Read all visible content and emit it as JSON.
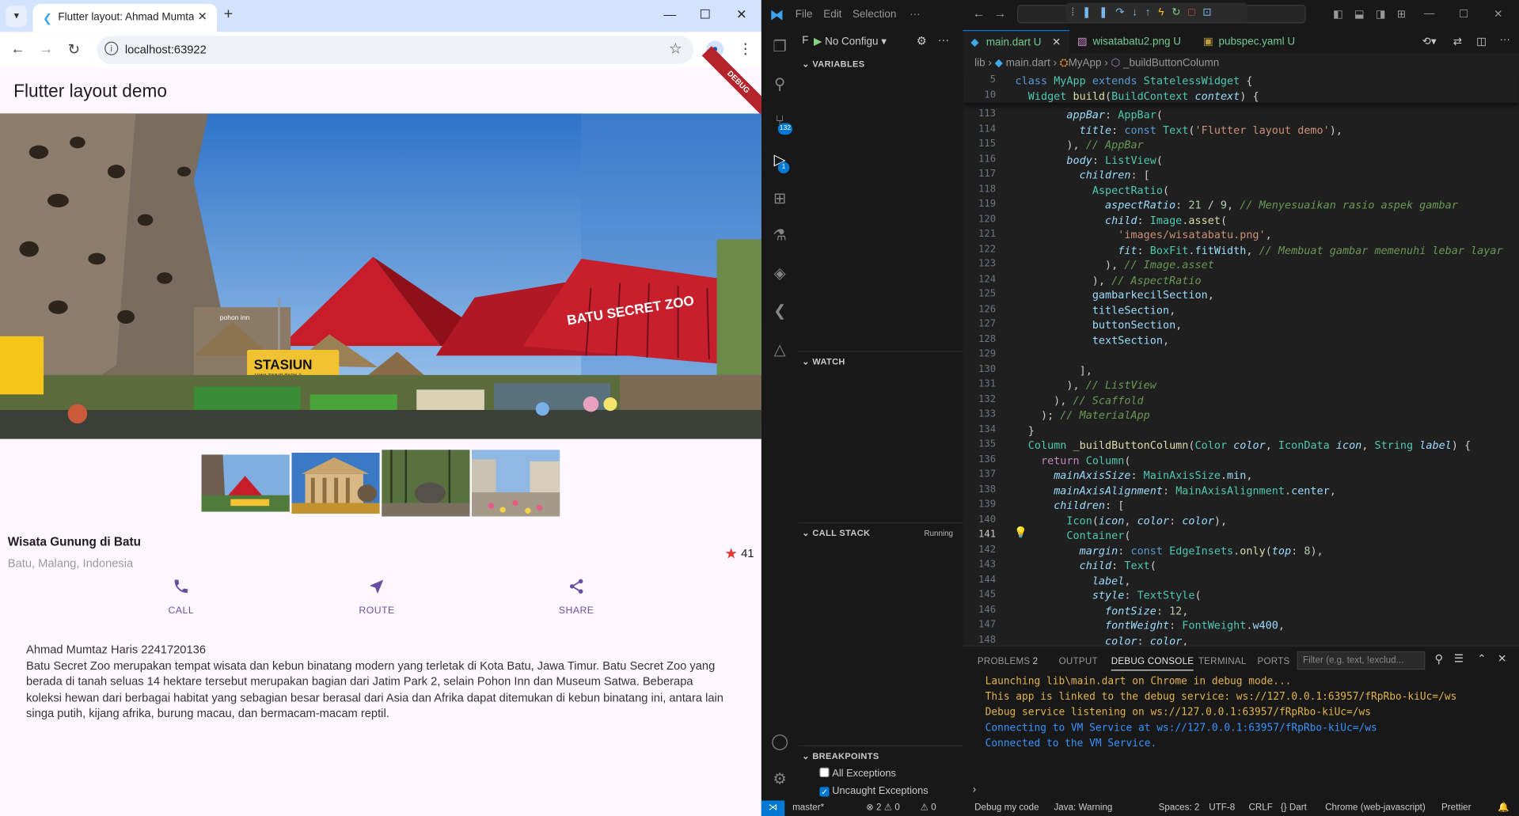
{
  "browser": {
    "tab_title": "Flutter layout: Ahmad Mumtaz",
    "url": "localhost:63922"
  },
  "app": {
    "title": "Flutter layout demo",
    "debug_banner": "DEBUG",
    "place_name": "Wisata Gunung di Batu",
    "location": "Batu, Malang, Indonesia",
    "rating_count": "41",
    "buttons": [
      {
        "label": "CALL"
      },
      {
        "label": "ROUTE"
      },
      {
        "label": "SHARE"
      }
    ],
    "author": "Ahmad Mumtaz Haris 2241720136",
    "description": "Batu Secret Zoo merupakan tempat wisata dan kebun binatang modern yang terletak di Kota Batu, Jawa Timur. Batu Secret Zoo yang berada di tanah seluas 14 hektare tersebut merupakan bagian dari Jatim Park 2, selain Pohon Inn dan Museum Satwa. Beberapa koleksi hewan dari berbagai habitat yang sebagian besar berasal dari Asia dan Afrika dapat ditemukan di kebun binatang ini, antara lain singa putih, kijang afrika, burung macau, dan bermacam-macam reptil.",
    "hero_signs": {
      "zoo": "BATU SECRET ZOO",
      "station": "STASIUN",
      "station_sub": "JAWA TIMUR PARK 2",
      "hotel": "pohon inn"
    }
  },
  "vscode": {
    "menu": [
      "File",
      "Edit",
      "Selection",
      "···"
    ],
    "run_config": "No Configu",
    "sections": {
      "variables": "VARIABLES",
      "watch": "WATCH",
      "call_stack": "CALL STACK",
      "call_stack_status": "Running",
      "breakpoints": "BREAKPOINTS"
    },
    "breakpoints": [
      {
        "label": "All Exceptions",
        "checked": false
      },
      {
        "label": "Uncaught Exceptions",
        "checked": true
      }
    ],
    "badges": {
      "source_control": "132",
      "debug": "1"
    },
    "tabs": [
      {
        "label": "main.dart",
        "suffix": "U"
      },
      {
        "label": "wisatabatu2.png",
        "suffix": "U"
      },
      {
        "label": "pubspec.yaml",
        "suffix": "U"
      }
    ],
    "breadcrumb": [
      "lib",
      "main.dart",
      "MyApp",
      "_buildButtonColumn"
    ],
    "panel_tabs": [
      "PROBLEMS",
      "2",
      "OUTPUT",
      "DEBUG CONSOLE",
      "TERMINAL",
      "PORTS"
    ],
    "filter_placeholder": "Filter (e.g. text, !exclud...",
    "console": [
      "Launching lib\\main.dart on Chrome in debug mode...",
      "This app is linked to the debug service: ws://127.0.0.1:63957/fRpRbo-kiUc=/ws",
      "Debug service listening on ws://127.0.0.1:63957/fRpRbo-kiUc=/ws",
      "Connecting to VM Service at ws://127.0.0.1:63957/fRpRbo-kiUc=/ws",
      "Connected to the VM Service."
    ],
    "status": [
      "master*",
      "⊗ 2 ⚠ 0",
      "⚠ 0",
      "Debug my code",
      "Java: Warning",
      "Spaces: 2",
      "UTF-8",
      "CRLF",
      "{} Dart",
      "Chrome (web-javascript)",
      "Prettier"
    ],
    "code_sticky": [
      {
        "n": "5",
        "html": "<span class='kb'>class</span> <span class='t'>MyApp</span> <span class='kb'>extends</span> <span class='t'>StatelessWidget</span> {"
      },
      {
        "n": "10",
        "html": "  <span class='t'>Widget</span> <span class='f'>build</span>(<span class='t'>BuildContext</span> <span class='p'>context</span>) {"
      }
    ],
    "code": [
      {
        "n": "113",
        "html": "        <span class='pr ital'>appBar</span>: <span class='t'>AppBar</span>("
      },
      {
        "n": "114",
        "html": "          <span class='pr ital'>title</span>: <span class='kb'>const</span> <span class='t'>Text</span>(<span class='s'>'Flutter layout demo'</span>),"
      },
      {
        "n": "115",
        "html": "        ), <span class='c'>// AppBar</span>"
      },
      {
        "n": "116",
        "html": "        <span class='pr ital'>body</span>: <span class='t'>ListView</span>("
      },
      {
        "n": "117",
        "html": "          <span class='pr ital'>children</span>: ["
      },
      {
        "n": "118",
        "html": "            <span class='t'>AspectRatio</span>("
      },
      {
        "n": "119",
        "html": "              <span class='pr ital'>aspectRatio</span>: <span class='n'>21</span> / <span class='n'>9</span>, <span class='c'>// Menyesuaikan rasio aspek gambar</span>"
      },
      {
        "n": "120",
        "html": "              <span class='pr ital'>child</span>: <span class='t'>Image</span>.<span class='f'>asset</span>("
      },
      {
        "n": "121",
        "html": "                <span class='s'>'images/wisatabatu.png'</span>,"
      },
      {
        "n": "122",
        "html": "                <span class='pr ital'>fit</span>: <span class='t'>BoxFit</span>.<span class='pr'>fitWidth</span>, <span class='c'>// Membuat gambar memenuhi lebar layar</span>"
      },
      {
        "n": "123",
        "html": "              ), <span class='c'>// Image.asset</span>"
      },
      {
        "n": "124",
        "html": "            ), <span class='c'>// AspectRatio</span>"
      },
      {
        "n": "125",
        "html": "            <span class='pr'>gambarkecilSection</span>,"
      },
      {
        "n": "126",
        "html": "            <span class='pr'>titleSection</span>,"
      },
      {
        "n": "127",
        "html": "            <span class='pr'>buttonSection</span>,"
      },
      {
        "n": "128",
        "html": "            <span class='pr'>textSection</span>,"
      },
      {
        "n": "129",
        "html": ""
      },
      {
        "n": "130",
        "html": "          ],"
      },
      {
        "n": "131",
        "html": "        ), <span class='c'>// ListView</span>"
      },
      {
        "n": "132",
        "html": "      ), <span class='c'>// Scaffold</span>"
      },
      {
        "n": "133",
        "html": "    ); <span class='c'>// MaterialApp</span>"
      },
      {
        "n": "134",
        "html": "  }"
      },
      {
        "n": "135",
        "html": "  <span class='t'>Column</span> <span class='f'>_buildButtonColumn</span>(<span class='t'>Color</span> <span class='p'>color</span>, <span class='t'>IconData</span> <span class='p'>icon</span>, <span class='t'>String</span> <span class='p'>label</span>) {"
      },
      {
        "n": "136",
        "html": "    <span class='k'>return</span> <span class='t'>Column</span>("
      },
      {
        "n": "137",
        "html": "      <span class='pr ital'>mainAxisSize</span>: <span class='t'>MainAxisSize</span>.<span class='pr'>min</span>,"
      },
      {
        "n": "138",
        "html": "      <span class='pr ital'>mainAxisAlignment</span>: <span class='t'>MainAxisAlignment</span>.<span class='pr'>center</span>,"
      },
      {
        "n": "139",
        "html": "      <span class='pr ital'>children</span>: ["
      },
      {
        "n": "140",
        "html": "        <span class='t'>Icon</span>(<span class='p'>icon</span>, <span class='pr ital'>color</span>: <span class='p'>color</span>),"
      },
      {
        "n": "141",
        "html": "        <span class='t'>Container</span>("
      },
      {
        "n": "142",
        "html": "          <span class='pr ital'>margin</span>: <span class='kb'>const</span> <span class='t'>EdgeInsets</span>.<span class='f'>only</span>(<span class='pr ital'>top</span>: <span class='n'>8</span>),"
      },
      {
        "n": "143",
        "html": "          <span class='pr ital'>child</span>: <span class='t'>Text</span>("
      },
      {
        "n": "144",
        "html": "            <span class='p'>label</span>,"
      },
      {
        "n": "145",
        "html": "            <span class='pr ital'>style</span>: <span class='t'>TextStyle</span>("
      },
      {
        "n": "146",
        "html": "              <span class='pr ital'>fontSize</span>: <span class='n'>12</span>,"
      },
      {
        "n": "147",
        "html": "              <span class='pr ital'>fontWeight</span>: <span class='t'>FontWeight</span>.<span class='pr'>w400</span>,"
      },
      {
        "n": "148",
        "html": "              <span class='pr ital'>color</span>: <span class='p'>color</span>,"
      }
    ]
  }
}
